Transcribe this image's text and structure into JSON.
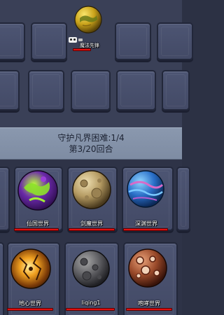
{
  "enemy_planet": {
    "label": "魔法先锋",
    "color": "#c9a21a"
  },
  "status": {
    "line1": "守护凡界困难:1/4",
    "line2": "第3/20回合"
  },
  "player_planets": [
    {
      "label": "仙国世界",
      "icon": "purple-green-planet-icon"
    },
    {
      "label": "剑魔世界",
      "icon": "tan-crater-planet-icon"
    },
    {
      "label": "深渊世界",
      "icon": "blue-swirl-planet-icon"
    },
    {
      "label": "地心世界",
      "icon": "cracked-lava-planet-icon"
    },
    {
      "label": "liqing1",
      "icon": "grey-moon-planet-icon"
    },
    {
      "label": "咆哮世界",
      "icon": "brown-spotted-planet-icon"
    }
  ]
}
